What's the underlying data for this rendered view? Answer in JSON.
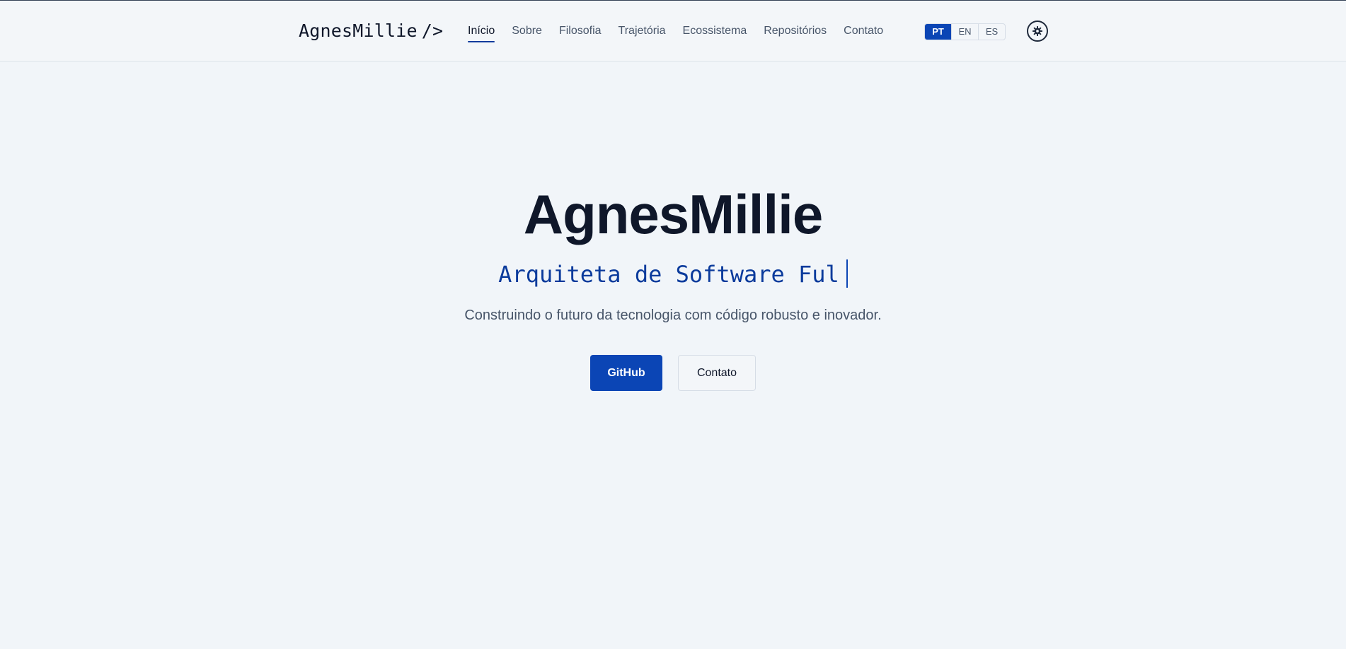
{
  "header": {
    "logo_text": "AgnesMillie",
    "logo_suffix": "/>",
    "nav": [
      {
        "label": "Início",
        "active": true
      },
      {
        "label": "Sobre",
        "active": false
      },
      {
        "label": "Filosofia",
        "active": false
      },
      {
        "label": "Trajetória",
        "active": false
      },
      {
        "label": "Ecossistema",
        "active": false
      },
      {
        "label": "Repositórios",
        "active": false
      },
      {
        "label": "Contato",
        "active": false
      }
    ],
    "languages": [
      "PT",
      "EN",
      "ES"
    ],
    "active_language": "PT",
    "theme_toggle_icon": "gear-icon"
  },
  "hero": {
    "title": "AgnesMillie",
    "subtitle": "Arquiteta de Software Ful",
    "description": "Construindo o futuro da tecnologia com código robusto e inovador.",
    "buttons": {
      "github": "GitHub",
      "contact": "Contato"
    }
  },
  "colors": {
    "accent": "#0b45b5",
    "background": "#f1f5f9",
    "text": "#0f172a",
    "muted": "#475569"
  }
}
